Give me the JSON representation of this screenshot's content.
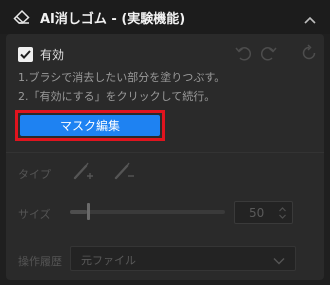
{
  "header": {
    "title": "AI消しゴム - (実験機能)",
    "icon": "eraser-icon",
    "chevron_icon": "chevron-up-icon"
  },
  "enable": {
    "label": "有効",
    "checked": true
  },
  "toolbar": {
    "undo_icon": "undo-icon",
    "redo_icon": "redo-icon",
    "reset_icon": "reset-icon"
  },
  "instructions": {
    "line1": "1.ブラシで消去したい部分を塗りつぶす。",
    "line2": "2.「有効にする」をクリックして続行。"
  },
  "mask_button": {
    "label": "マスク編集",
    "color": "#1e82f2",
    "highlight_color": "#e0141e"
  },
  "type": {
    "label": "タイプ",
    "add_icon": "brush-add-icon",
    "remove_icon": "brush-remove-icon"
  },
  "size": {
    "label": "サイズ",
    "value": "50",
    "slider_level": 0.11
  },
  "history": {
    "label": "操作履歴",
    "selected": "元ファイル"
  }
}
